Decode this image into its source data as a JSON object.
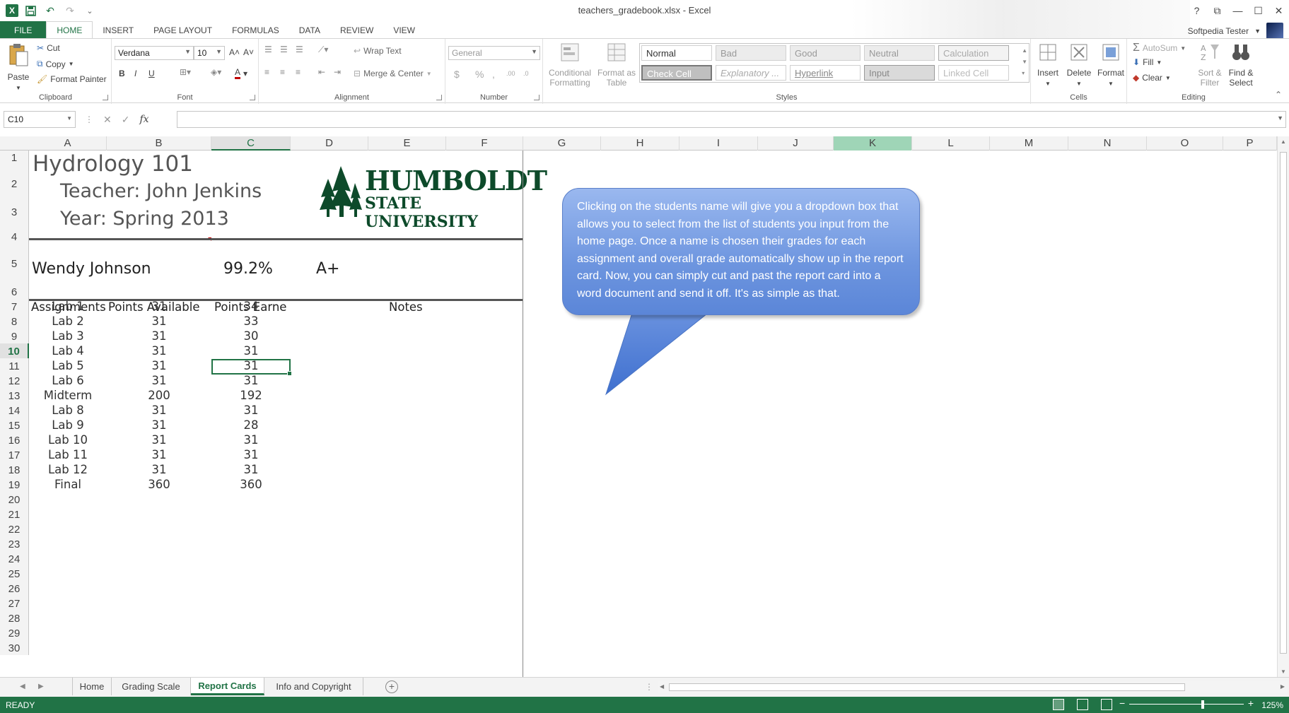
{
  "window": {
    "title": "teachers_gradebook.xlsx - Excel",
    "buttons": [
      "?",
      "⧉",
      "—",
      "☐",
      "✕"
    ]
  },
  "qat": {
    "undo": "↶",
    "redo": "↷",
    "more": "⌄"
  },
  "ribbon_tabs": [
    "FILE",
    "HOME",
    "INSERT",
    "PAGE LAYOUT",
    "FORMULAS",
    "DATA",
    "REVIEW",
    "VIEW"
  ],
  "active_tab": "HOME",
  "user": {
    "name": "Softpedia Tester"
  },
  "ribbon": {
    "clipboard": {
      "paste": "Paste",
      "cut": "Cut",
      "copy": "Copy",
      "format_painter": "Format Painter",
      "label": "Clipboard"
    },
    "font": {
      "name": "Verdana",
      "size": "10",
      "label": "Font",
      "bold": "B",
      "italic": "I",
      "underline": "U",
      "grow": "A˄",
      "shrink": "A˅",
      "font_color": "A"
    },
    "alignment": {
      "wrap_text": "Wrap Text",
      "merge_center": "Merge & Center",
      "label": "Alignment"
    },
    "number": {
      "format": "General",
      "currency": "$",
      "percent": "%",
      "comma": ",",
      "inc_dec": ".00",
      "dec_dec": ".0",
      "label": "Number"
    },
    "styles": {
      "conditional_formatting": "Conditional Formatting",
      "format_as_table": "Format as Table",
      "cells": [
        "Normal",
        "Bad",
        "Good",
        "Neutral",
        "Calculation",
        "Check Cell",
        "Explanatory ...",
        "Hyperlink",
        "Input",
        "Linked Cell"
      ],
      "label": "Styles"
    },
    "cells": {
      "insert": "Insert",
      "delete": "Delete",
      "format": "Format",
      "label": "Cells"
    },
    "editing": {
      "autosum": "AutoSum",
      "fill": "Fill",
      "clear": "Clear",
      "sort_filter": "Sort & Filter",
      "find_select": "Find & Select",
      "label": "Editing",
      "sigma": "Σ"
    }
  },
  "formula_bar": {
    "name_box": "C10",
    "fx": "fx",
    "value": ""
  },
  "columns": [
    "A",
    "B",
    "C",
    "D",
    "E",
    "F",
    "G",
    "H",
    "I",
    "J",
    "K",
    "L",
    "M",
    "N",
    "O",
    "P"
  ],
  "rows": [
    "1",
    "2",
    "3",
    "4",
    "5",
    "6",
    "7",
    "8",
    "9",
    "10",
    "11",
    "12",
    "13",
    "14",
    "15",
    "16",
    "17",
    "18",
    "19",
    "20",
    "21",
    "22",
    "23",
    "24",
    "25",
    "26",
    "27",
    "28",
    "29",
    "30"
  ],
  "sheet": {
    "title": "Hydrology 101",
    "teacher": "Teacher: John Jenkins",
    "year": "Year: Spring 2013",
    "student": "Wendy Johnson",
    "percent": "99.2%",
    "grade": "A+",
    "headers": {
      "assignments": "Assignments",
      "available": "Points Available",
      "earned": "Points Earne",
      "notes": "Notes"
    },
    "assignments": [
      {
        "name": "Lab 1",
        "available": "31",
        "earned": "34"
      },
      {
        "name": "Lab 2",
        "available": "31",
        "earned": "33"
      },
      {
        "name": "Lab 3",
        "available": "31",
        "earned": "30"
      },
      {
        "name": "Lab 4",
        "available": "31",
        "earned": "31"
      },
      {
        "name": "Lab 5",
        "available": "31",
        "earned": "31"
      },
      {
        "name": "Lab 6",
        "available": "31",
        "earned": "31"
      },
      {
        "name": "Midterm",
        "available": "200",
        "earned": "192"
      },
      {
        "name": "Lab 8",
        "available": "31",
        "earned": "31"
      },
      {
        "name": "Lab 9",
        "available": "31",
        "earned": "28"
      },
      {
        "name": "Lab 10",
        "available": "31",
        "earned": "31"
      },
      {
        "name": "Lab 11",
        "available": "31",
        "earned": "31"
      },
      {
        "name": "Lab 12",
        "available": "31",
        "earned": "31"
      },
      {
        "name": "Final",
        "available": "360",
        "earned": "360"
      }
    ],
    "logo": {
      "line1": "HUMBOLDT",
      "line2": "STATE UNIVERSITY"
    }
  },
  "callout": {
    "text": "Clicking on the students name will give you a dropdown box that allows you to select from the list of students you input from the home page. Once a name is chosen their grades for each assignment and overall grade automatically show up in the report card. Now, you can simply cut and past the report card into a word document and send it off. It's as simple as that."
  },
  "sheet_tabs": [
    "Home",
    "Grading Scale",
    "Report Cards",
    "Info and Copyright"
  ],
  "active_sheet": "Report Cards",
  "status": {
    "text": "READY",
    "zoom": "125%"
  },
  "colors": {
    "excel_green": "#217346",
    "selection_highlight": "#9fd5b7",
    "callout_blue": "#6d95df",
    "logo_green": "#0d4a2a"
  }
}
